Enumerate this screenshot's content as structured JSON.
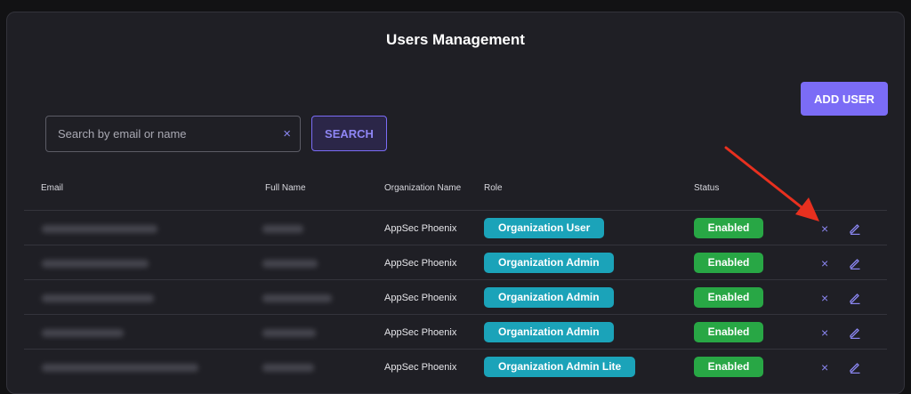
{
  "page": {
    "title": "Users Management"
  },
  "toolbar": {
    "add_user_label": "ADD USER"
  },
  "search": {
    "placeholder": "Search by email or name",
    "value": "",
    "clear_icon": "×",
    "button_label": "SEARCH"
  },
  "table": {
    "headers": {
      "email": "Email",
      "full_name": "Full Name",
      "organization": "Organization Name",
      "role": "Role",
      "status": "Status"
    },
    "rows": [
      {
        "organization": "AppSec Phoenix",
        "role": "Organization User",
        "status": "Enabled"
      },
      {
        "organization": "AppSec Phoenix",
        "role": "Organization Admin",
        "status": "Enabled"
      },
      {
        "organization": "AppSec Phoenix",
        "role": "Organization Admin",
        "status": "Enabled"
      },
      {
        "organization": "AppSec Phoenix",
        "role": "Organization Admin",
        "status": "Enabled"
      },
      {
        "organization": "AppSec Phoenix",
        "role": "Organization Admin Lite",
        "status": "Enabled"
      }
    ],
    "actions": {
      "delete_icon": "×",
      "edit_icon": "pencil-icon"
    }
  },
  "colors": {
    "accent": "#7b6cf6",
    "role_badge": "#1ba3b9",
    "status_enabled": "#28a745",
    "annotation_arrow": "#e8301f"
  }
}
